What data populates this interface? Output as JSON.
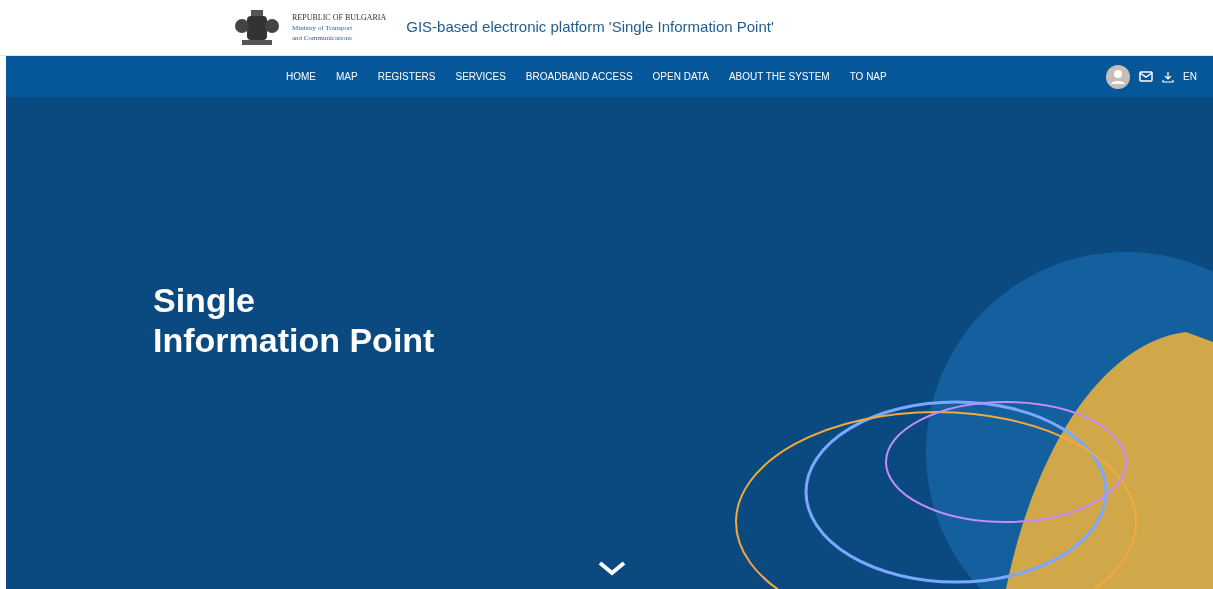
{
  "header": {
    "emblem_lines": [
      "REPUBLIC OF BULGARIA",
      "Ministry of Transport",
      "and Communications"
    ],
    "title": "GIS-based electronic platform 'Single Information Point'"
  },
  "nav": {
    "items": [
      "HOME",
      "MAP",
      "REGISTERS",
      "SERVICES",
      "BROADBAND ACCESS",
      "OPEN DATA",
      "ABOUT THE SYSTEM",
      "TO NAP"
    ],
    "language": "EN"
  },
  "hero": {
    "title_lines": [
      "Single",
      "Information Point"
    ]
  }
}
